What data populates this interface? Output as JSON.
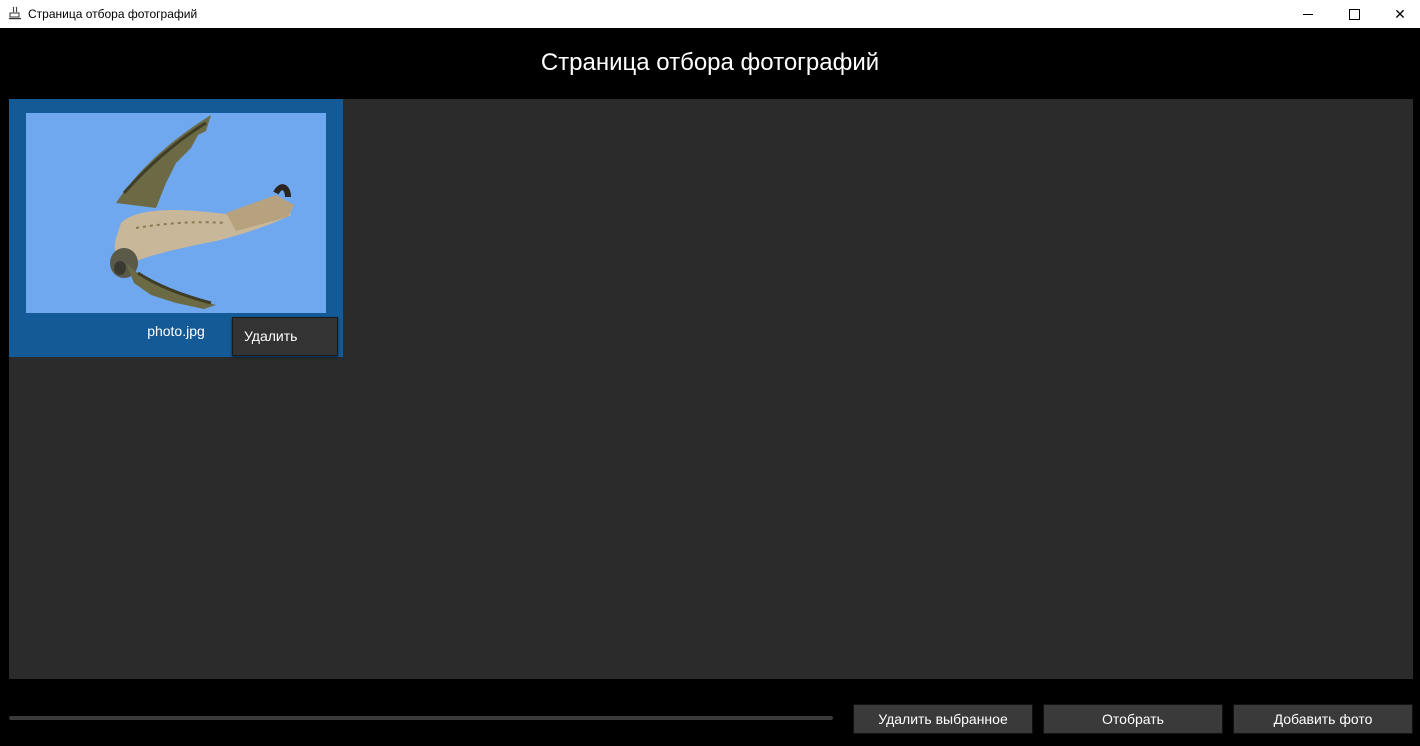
{
  "window": {
    "title": "Страница отбора фотографий",
    "controls": {
      "minimize_icon": "minimize-icon",
      "maximize_icon": "maximize-icon",
      "close_icon": "close-icon",
      "close_glyph": "✕"
    }
  },
  "header": {
    "title": "Страница отбора фотографий"
  },
  "gallery": {
    "photos": [
      {
        "filename": "photo.jpg",
        "selected": true,
        "image": "kestrel-bird-in-flight-thumbnail"
      }
    ]
  },
  "context_menu": {
    "items": [
      {
        "label": "Удалить"
      }
    ]
  },
  "footer": {
    "progress": 0,
    "buttons": {
      "delete_selected": "Удалить выбранное",
      "select": "Отобрать",
      "add_photo": "Добавить фото"
    }
  },
  "colors": {
    "background": "#000000",
    "gallery_bg": "#2b2b2b",
    "selection": "#135a96",
    "button_bg": "#3a3a3a"
  }
}
